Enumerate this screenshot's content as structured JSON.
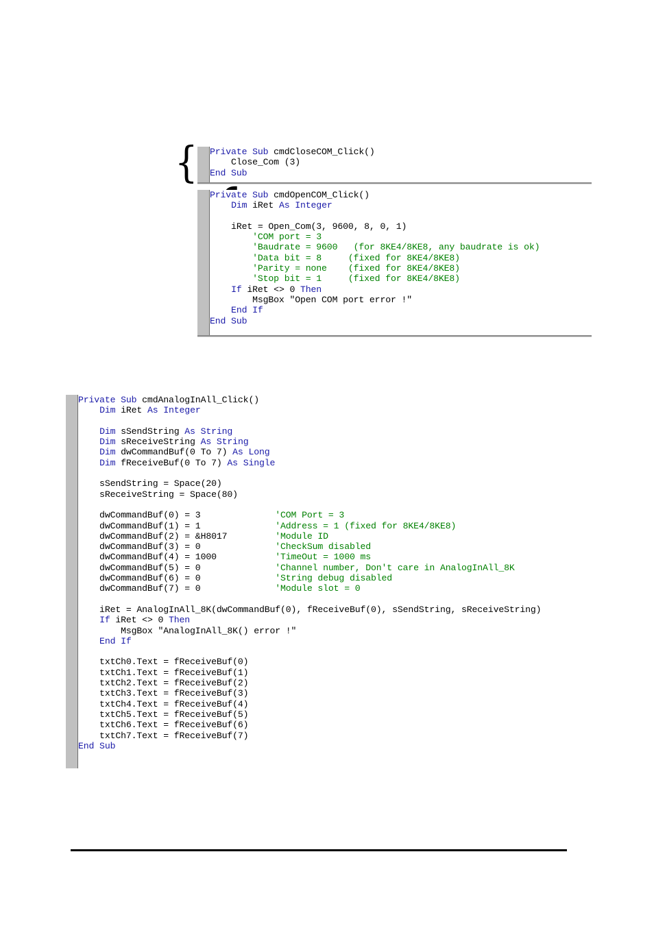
{
  "document": {
    "type": "code-listing-document",
    "background_color": "#ffffff",
    "keyword_color": "#1a1aa8",
    "comment_color": "#008000",
    "text_color": "#000000",
    "gutter_color": "#c0c0c0"
  },
  "block_close_com": {
    "name": "cmdCloseCOM_Click",
    "brace_glyph": "{",
    "lines": [
      {
        "segments": [
          {
            "t": "Private Sub ",
            "c": "kw"
          },
          {
            "t": "cmdCloseCOM_Click()",
            "c": ""
          }
        ]
      },
      {
        "segments": [
          {
            "t": "    Close_Com (3)",
            "c": ""
          }
        ]
      },
      {
        "segments": [
          {
            "t": "End Sub",
            "c": "kw"
          }
        ]
      }
    ]
  },
  "block_open_com": {
    "name": "cmdOpenCOM_Click",
    "brace_glyph": "{",
    "lines": [
      {
        "segments": [
          {
            "t": "Private Sub ",
            "c": "kw"
          },
          {
            "t": "cmdOpenCOM_Click()",
            "c": ""
          }
        ]
      },
      {
        "segments": [
          {
            "t": "    ",
            "c": ""
          },
          {
            "t": "Dim ",
            "c": "kw"
          },
          {
            "t": "iRet ",
            "c": ""
          },
          {
            "t": "As Integer",
            "c": "kw"
          }
        ]
      },
      {
        "segments": [
          {
            "t": "",
            "c": ""
          }
        ]
      },
      {
        "segments": [
          {
            "t": "    iRet = Open_Com(3, 9600, 8, 0, 1)",
            "c": ""
          }
        ]
      },
      {
        "segments": [
          {
            "t": "        'COM port = 3",
            "c": "cmt"
          }
        ]
      },
      {
        "segments": [
          {
            "t": "        'Baudrate = 9600   (for 8KE4/8KE8, any baudrate is ok)",
            "c": "cmt"
          }
        ]
      },
      {
        "segments": [
          {
            "t": "        'Data bit = 8     (fixed for 8KE4/8KE8)",
            "c": "cmt"
          }
        ]
      },
      {
        "segments": [
          {
            "t": "        'Parity = none    (fixed for 8KE4/8KE8)",
            "c": "cmt"
          }
        ]
      },
      {
        "segments": [
          {
            "t": "        'Stop bit = 1     (fixed for 8KE4/8KE8)",
            "c": "cmt"
          }
        ]
      },
      {
        "segments": [
          {
            "t": "    ",
            "c": ""
          },
          {
            "t": "If ",
            "c": "kw"
          },
          {
            "t": "iRet <> 0 ",
            "c": ""
          },
          {
            "t": "Then",
            "c": "kw"
          }
        ]
      },
      {
        "segments": [
          {
            "t": "        MsgBox \"Open COM port error !\"",
            "c": ""
          }
        ]
      },
      {
        "segments": [
          {
            "t": "    End If",
            "c": "kw"
          }
        ]
      },
      {
        "segments": [
          {
            "t": "End Sub",
            "c": "kw"
          }
        ]
      }
    ]
  },
  "block_analog_in_all": {
    "name": "cmdAnalogInAll_Click",
    "lines": [
      {
        "segments": [
          {
            "t": "Private Sub ",
            "c": "kw"
          },
          {
            "t": "cmdAnalogInAll_Click()",
            "c": ""
          }
        ]
      },
      {
        "segments": [
          {
            "t": "    ",
            "c": ""
          },
          {
            "t": "Dim ",
            "c": "kw"
          },
          {
            "t": "iRet ",
            "c": ""
          },
          {
            "t": "As Integer",
            "c": "kw"
          }
        ]
      },
      {
        "segments": [
          {
            "t": "",
            "c": ""
          }
        ]
      },
      {
        "segments": [
          {
            "t": "    ",
            "c": ""
          },
          {
            "t": "Dim ",
            "c": "kw"
          },
          {
            "t": "sSendString ",
            "c": ""
          },
          {
            "t": "As String",
            "c": "kw"
          }
        ]
      },
      {
        "segments": [
          {
            "t": "    ",
            "c": ""
          },
          {
            "t": "Dim ",
            "c": "kw"
          },
          {
            "t": "sReceiveString ",
            "c": ""
          },
          {
            "t": "As String",
            "c": "kw"
          }
        ]
      },
      {
        "segments": [
          {
            "t": "    ",
            "c": ""
          },
          {
            "t": "Dim ",
            "c": "kw"
          },
          {
            "t": "dwCommandBuf(0 To 7) ",
            "c": ""
          },
          {
            "t": "As Long",
            "c": "kw"
          }
        ]
      },
      {
        "segments": [
          {
            "t": "    ",
            "c": ""
          },
          {
            "t": "Dim ",
            "c": "kw"
          },
          {
            "t": "fReceiveBuf(0 To 7) ",
            "c": ""
          },
          {
            "t": "As Single",
            "c": "kw"
          }
        ]
      },
      {
        "segments": [
          {
            "t": "",
            "c": ""
          }
        ]
      },
      {
        "segments": [
          {
            "t": "    sSendString = Space(20)",
            "c": ""
          }
        ]
      },
      {
        "segments": [
          {
            "t": "    sReceiveString = Space(80)",
            "c": ""
          }
        ]
      },
      {
        "segments": [
          {
            "t": "",
            "c": ""
          }
        ]
      },
      {
        "segments": [
          {
            "t": "    dwCommandBuf(0) = 3              ",
            "c": ""
          },
          {
            "t": "'COM Port = 3",
            "c": "cmt"
          }
        ]
      },
      {
        "segments": [
          {
            "t": "    dwCommandBuf(1) = 1              ",
            "c": ""
          },
          {
            "t": "'Address = 1 (fixed for 8KE4/8KE8)",
            "c": "cmt"
          }
        ]
      },
      {
        "segments": [
          {
            "t": "    dwCommandBuf(2) = &H8017         ",
            "c": ""
          },
          {
            "t": "'Module ID",
            "c": "cmt"
          }
        ]
      },
      {
        "segments": [
          {
            "t": "    dwCommandBuf(3) = 0              ",
            "c": ""
          },
          {
            "t": "'CheckSum disabled",
            "c": "cmt"
          }
        ]
      },
      {
        "segments": [
          {
            "t": "    dwCommandBuf(4) = 1000           ",
            "c": ""
          },
          {
            "t": "'TimeOut = 1000 ms",
            "c": "cmt"
          }
        ]
      },
      {
        "segments": [
          {
            "t": "    dwCommandBuf(5) = 0              ",
            "c": ""
          },
          {
            "t": "'Channel number, Don't care in AnalogInAll_8K",
            "c": "cmt"
          }
        ]
      },
      {
        "segments": [
          {
            "t": "    dwCommandBuf(6) = 0              ",
            "c": ""
          },
          {
            "t": "'String debug disabled",
            "c": "cmt"
          }
        ]
      },
      {
        "segments": [
          {
            "t": "    dwCommandBuf(7) = 0              ",
            "c": ""
          },
          {
            "t": "'Module slot = 0",
            "c": "cmt"
          }
        ]
      },
      {
        "segments": [
          {
            "t": "",
            "c": ""
          }
        ]
      },
      {
        "segments": [
          {
            "t": "    iRet = AnalogInAll_8K(dwCommandBuf(0), fReceiveBuf(0), sSendString, sReceiveString)",
            "c": ""
          }
        ]
      },
      {
        "segments": [
          {
            "t": "    ",
            "c": ""
          },
          {
            "t": "If ",
            "c": "kw"
          },
          {
            "t": "iRet <> 0 ",
            "c": ""
          },
          {
            "t": "Then",
            "c": "kw"
          }
        ]
      },
      {
        "segments": [
          {
            "t": "        MsgBox \"AnalogInAll_8K() error !\"",
            "c": ""
          }
        ]
      },
      {
        "segments": [
          {
            "t": "    End If",
            "c": "kw"
          }
        ]
      },
      {
        "segments": [
          {
            "t": "",
            "c": ""
          }
        ]
      },
      {
        "segments": [
          {
            "t": "    txtCh0.Text = fReceiveBuf(0)",
            "c": ""
          }
        ]
      },
      {
        "segments": [
          {
            "t": "    txtCh1.Text = fReceiveBuf(1)",
            "c": ""
          }
        ]
      },
      {
        "segments": [
          {
            "t": "    txtCh2.Text = fReceiveBuf(2)",
            "c": ""
          }
        ]
      },
      {
        "segments": [
          {
            "t": "    txtCh3.Text = fReceiveBuf(3)",
            "c": ""
          }
        ]
      },
      {
        "segments": [
          {
            "t": "    txtCh4.Text = fReceiveBuf(4)",
            "c": ""
          }
        ]
      },
      {
        "segments": [
          {
            "t": "    txtCh5.Text = fReceiveBuf(5)",
            "c": ""
          }
        ]
      },
      {
        "segments": [
          {
            "t": "    txtCh6.Text = fReceiveBuf(6)",
            "c": ""
          }
        ]
      },
      {
        "segments": [
          {
            "t": "    txtCh7.Text = fReceiveBuf(7)",
            "c": ""
          }
        ]
      },
      {
        "segments": [
          {
            "t": "End Sub",
            "c": "kw"
          }
        ]
      }
    ]
  }
}
